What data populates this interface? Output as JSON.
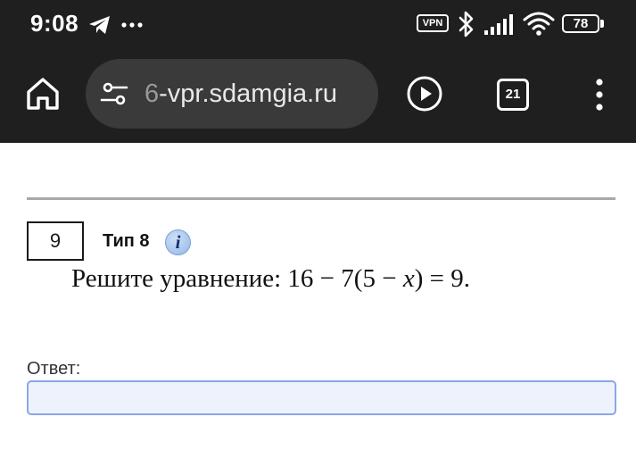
{
  "status_bar": {
    "time": "9:08",
    "vpn_label": "VPN",
    "battery_level": "78",
    "icons": [
      "telegram-icon",
      "more-notifications-icon",
      "vpn-icon",
      "bluetooth-icon",
      "cell-signal-icon",
      "wifi-icon",
      "battery-icon"
    ]
  },
  "browser": {
    "url_faded": "6",
    "url_main": "-vpr.sdamgia.ru",
    "tab_count": "21",
    "icons": [
      "home-icon",
      "site-settings-icon",
      "play-icon",
      "tabs-icon",
      "menu-icon"
    ]
  },
  "task": {
    "number": "9",
    "type_label": "Тип 8",
    "info_glyph": "i",
    "text_before_var": "Решите уравнение: 16 − 7(5 − ",
    "variable": "x",
    "text_after_var": ")  =  9."
  },
  "answer": {
    "label": "Ответ:",
    "value": ""
  },
  "colors": {
    "chrome_background": "#1f1f1f",
    "url_pill": "#3a3a3a",
    "input_border": "#8aa6e8",
    "input_background": "#eef2fc",
    "divider": "#a8a8a8"
  }
}
